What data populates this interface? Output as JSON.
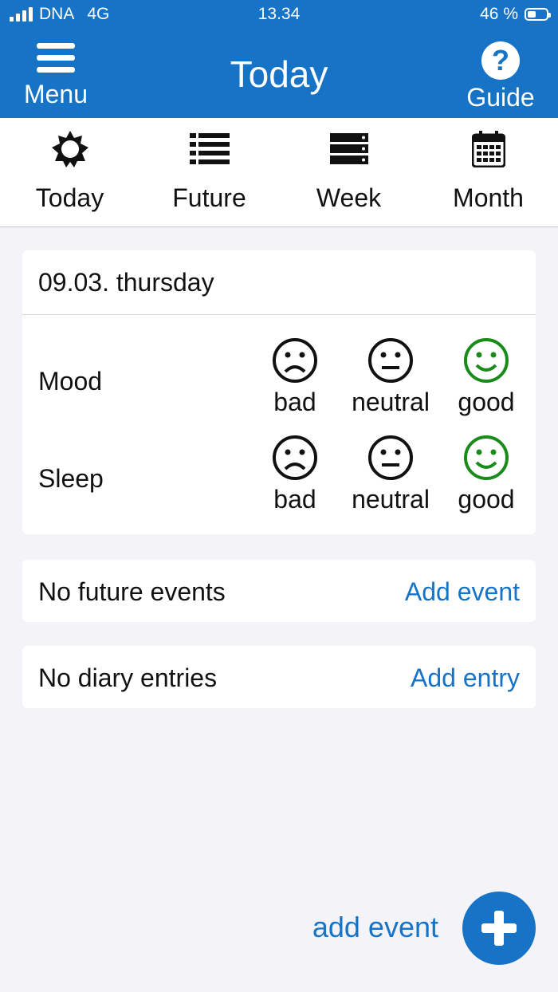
{
  "status_bar": {
    "carrier": "DNA",
    "network": "4G",
    "time": "13.34",
    "battery": "46 %",
    "battery_level": 0.46
  },
  "app_bar": {
    "menu_label": "Menu",
    "title": "Today",
    "guide_label": "Guide",
    "menu_icon": "hamburger-icon",
    "guide_icon": "question-circle-icon"
  },
  "tabs": [
    {
      "label": "Today",
      "icon": "sun-icon"
    },
    {
      "label": "Future",
      "icon": "list-icon"
    },
    {
      "label": "Week",
      "icon": "week-icon"
    },
    {
      "label": "Month",
      "icon": "calendar-icon"
    }
  ],
  "day_card": {
    "date": "09.03. thursday",
    "rows": [
      {
        "label": "Mood",
        "options": [
          "bad",
          "neutral",
          "good"
        ],
        "selected": "good"
      },
      {
        "label": "Sleep",
        "options": [
          "bad",
          "neutral",
          "good"
        ],
        "selected": "good"
      }
    ]
  },
  "events_card": {
    "text": "No future events",
    "link": "Add event"
  },
  "diary_card": {
    "text": "No diary entries",
    "link": "Add entry"
  },
  "fab": {
    "label": "add event",
    "icon": "plus-icon"
  },
  "colors": {
    "accent": "#1673c6",
    "good": "#1a8a1a",
    "background": "#f3f3f8"
  }
}
